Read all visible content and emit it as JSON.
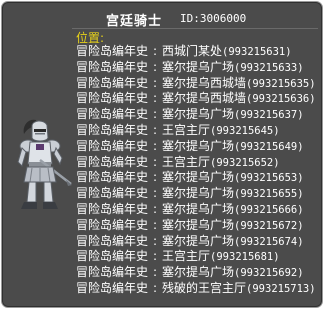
{
  "player": {
    "name": "宫廷骑士",
    "id_label": "ID:",
    "id_value": "3006000"
  },
  "section_label": "位置:",
  "location_rows": [
    {
      "world": "冒险岛编年史",
      "place": "西城门某处",
      "code": "(993215631)"
    },
    {
      "world": "冒险岛编年史",
      "place": "塞尔提乌广场",
      "code": "(993215633)"
    },
    {
      "world": "冒险岛编年史",
      "place": "塞尔提乌西城墙",
      "code": "(993215635)"
    },
    {
      "world": "冒险岛编年史",
      "place": "塞尔提乌西城墙",
      "code": "(993215636)"
    },
    {
      "world": "冒险岛编年史",
      "place": "塞尔提乌广场",
      "code": "(993215637)"
    },
    {
      "world": "冒险岛编年史",
      "place": "王宫主厅",
      "code": "(993215645)"
    },
    {
      "world": "冒险岛编年史",
      "place": "塞尔提乌广场",
      "code": "(993215649)"
    },
    {
      "world": "冒险岛编年史",
      "place": "王宫主厅",
      "code": "(993215652)"
    },
    {
      "world": "冒险岛编年史",
      "place": "塞尔提乌广场",
      "code": "(993215653)"
    },
    {
      "world": "冒险岛编年史",
      "place": "塞尔提乌广场",
      "code": "(993215655)"
    },
    {
      "world": "冒险岛编年史",
      "place": "塞尔提乌广场",
      "code": "(993215666)"
    },
    {
      "world": "冒险岛编年史",
      "place": "塞尔提乌广场",
      "code": "(993215672)"
    },
    {
      "world": "冒险岛编年史",
      "place": "塞尔提乌广场",
      "code": "(993215674)"
    },
    {
      "world": "冒险岛编年史",
      "place": "王宫主厅",
      "code": "(993215681)"
    },
    {
      "world": "冒险岛编年史",
      "place": "塞尔提乌广场",
      "code": "(993215692)"
    },
    {
      "world": "冒险岛编年史",
      "place": "残破的王宫主厅",
      "code": "(993215713)"
    }
  ],
  "row_separator": ":",
  "colors": {
    "panel_bg": "#4b4b4b",
    "text": "#ffffff",
    "section_label": "#e7d21a",
    "border": "#9a9a9a"
  },
  "icons": {
    "avatar": "armored-knight-sprite"
  }
}
